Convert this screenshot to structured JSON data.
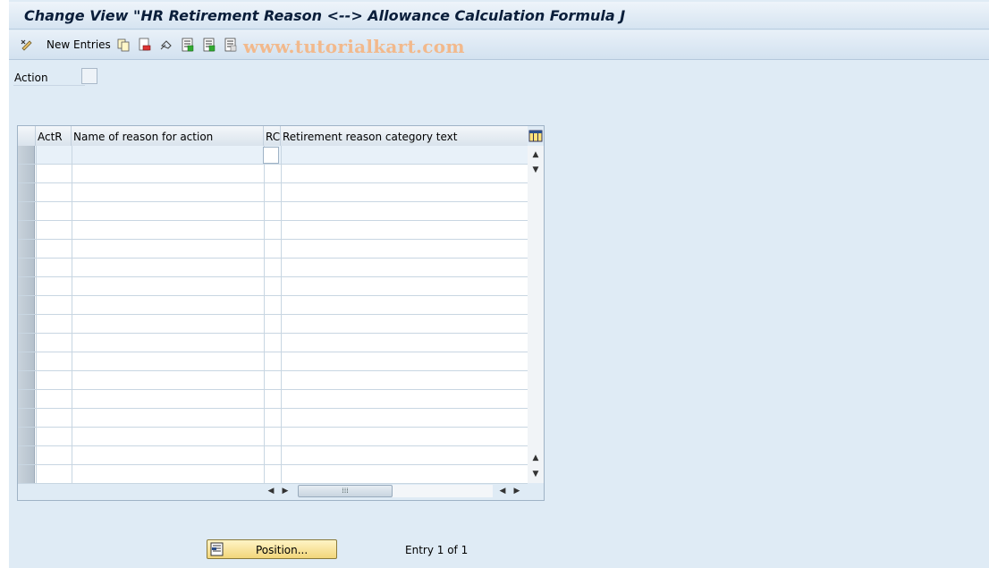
{
  "title": "Change View \"HR Retirement Reason <--> Allowance Calculation Formula J",
  "toolbar": {
    "new_entries_label": "New Entries",
    "icons": [
      "display-change-icon",
      "copy-icon",
      "delete-icon",
      "undo-icon",
      "select-all-icon",
      "select-block-icon",
      "deselect-all-icon"
    ]
  },
  "watermark": "www.tutorialkart.com",
  "action": {
    "label": "Action",
    "checked": false
  },
  "table": {
    "columns": [
      "ActR",
      "Name of reason for action",
      "RC",
      "Retirement reason category text"
    ],
    "row_count": 18
  },
  "footer": {
    "position_button_label": "Position...",
    "entry_text": "Entry 1 of 1"
  },
  "colors": {
    "background": "#dfebf5",
    "title_text": "#0a1e3a",
    "watermark": "#f2b98c",
    "button_yellow": "#f2d67a"
  }
}
